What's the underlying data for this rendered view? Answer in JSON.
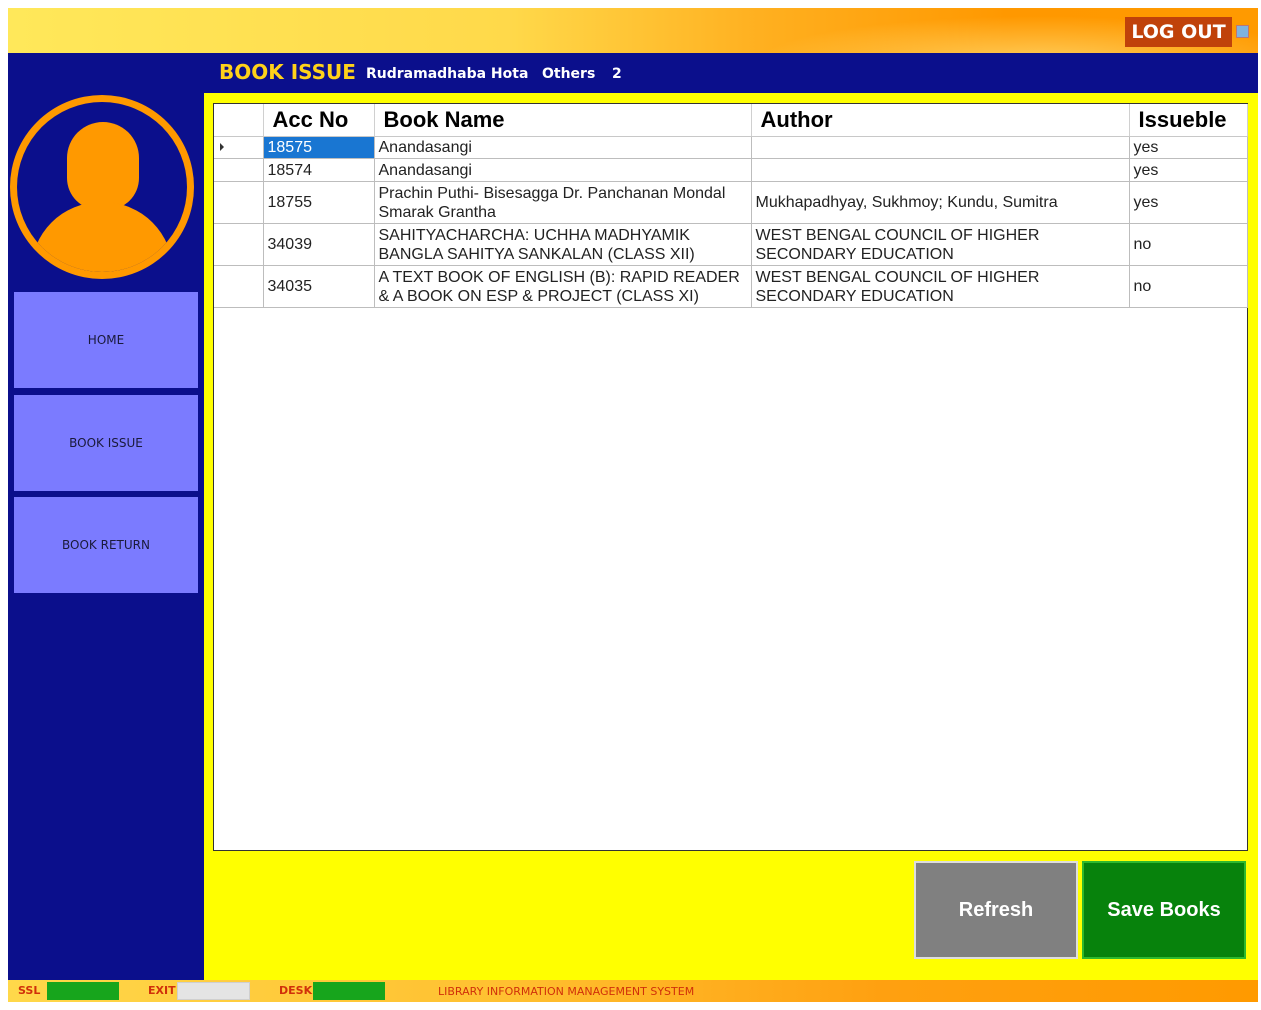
{
  "topbar": {
    "logout_label": "LOG OUT"
  },
  "header": {
    "title": "BOOK ISSUE",
    "user": "Rudramadhaba Hota",
    "category": "Others",
    "count": "2"
  },
  "sidebar": {
    "items": [
      {
        "label": "HOME"
      },
      {
        "label": "BOOK ISSUE"
      },
      {
        "label": "BOOK RETURN"
      }
    ]
  },
  "grid": {
    "columns": [
      "Acc No",
      "Book Name",
      "Author",
      "Issueble"
    ],
    "rows": [
      {
        "acc": "18575",
        "name": "Anandasangi",
        "author": "",
        "issuable": "yes"
      },
      {
        "acc": "18574",
        "name": "Anandasangi",
        "author": "",
        "issuable": "yes"
      },
      {
        "acc": "18755",
        "name": "Prachin Puthi- Bisesagga Dr. Panchanan Mondal Smarak Grantha",
        "author": "Mukhapadhyay, Sukhmoy; Kundu, Sumitra",
        "issuable": "yes"
      },
      {
        "acc": "34039",
        "name": "SAHITYACHARCHA: UCHHA MADHYAMIK BANGLA SAHITYA SANKALAN (CLASS XII)",
        "author": "WEST BENGAL COUNCIL OF HIGHER SECONDARY EDUCATION",
        "issuable": "no"
      },
      {
        "acc": "34035",
        "name": "A TEXT BOOK OF ENGLISH (B): RAPID READER & A BOOK ON ESP & PROJECT (CLASS XI)",
        "author": "WEST BENGAL COUNCIL OF HIGHER SECONDARY EDUCATION",
        "issuable": "no"
      }
    ]
  },
  "actions": {
    "refresh_label": "Refresh",
    "save_label": "Save Books"
  },
  "statusbar": {
    "ssl": "SSL",
    "exit": "EXIT",
    "desk": "DESK",
    "app_name": "LIBRARY INFORMATION MANAGEMENT SYSTEM"
  },
  "colors": {
    "sidebar": "#0b0f8c",
    "content": "#ffff00",
    "accent": "#ff9900",
    "nav_button": "#7b7bff",
    "save": "#07820c",
    "refresh": "#808080",
    "status_ok": "#17a51c"
  },
  "icons": {
    "avatar": "user-silhouette",
    "logout": "window-icon",
    "row_selector": "triangle-right"
  }
}
